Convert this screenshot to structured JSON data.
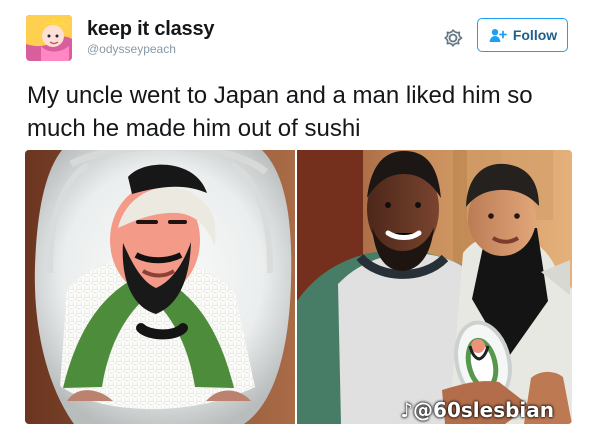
{
  "user": {
    "display_name": "keep it classy",
    "handle": "@odysseypeach"
  },
  "actions": {
    "follow_label": "Follow",
    "settings_icon": "gear-icon",
    "follow_icon": "add-user-icon"
  },
  "tweet": {
    "text": "My uncle went to Japan and a man liked him so much he made him out of sushi"
  },
  "media": {
    "left_photo": "sushi-portrait",
    "right_photo": "two-men-holding-sushi-plate",
    "watermark": "@60slesbian"
  },
  "colors": {
    "follow_text": "#1f5f8d",
    "follow_border": "#1da1f2",
    "secondary_text": "#8899a6"
  }
}
